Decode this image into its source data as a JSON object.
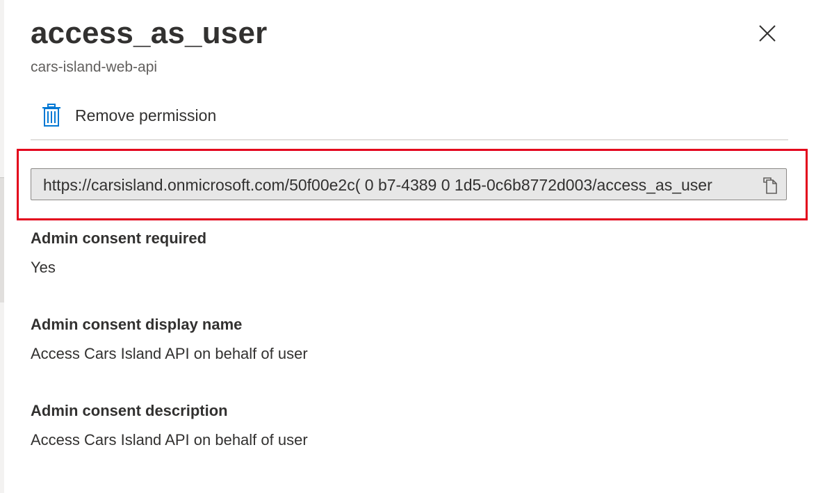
{
  "panel": {
    "title": "access_as_user",
    "subtitle": "cars-island-web-api"
  },
  "toolbar": {
    "remove_label": "Remove permission",
    "remove_icon": "trash-icon"
  },
  "scope_uri": {
    "value": "https://carsisland.onmicrosoft.com/50f00e2c( 0 b7-4389 0 1d5-0c6b8772d003/access_as_user",
    "copy_icon": "copy-icon"
  },
  "fields": [
    {
      "label": "Admin consent required",
      "value": "Yes"
    },
    {
      "label": "Admin consent display name",
      "value": "Access Cars Island API on behalf of user"
    },
    {
      "label": "Admin consent description",
      "value": "Access Cars Island API on behalf of user"
    }
  ],
  "colors": {
    "accent": "#0078d4",
    "highlight": "#e3001b",
    "text": "#323130",
    "secondary_text": "#605e5c"
  }
}
